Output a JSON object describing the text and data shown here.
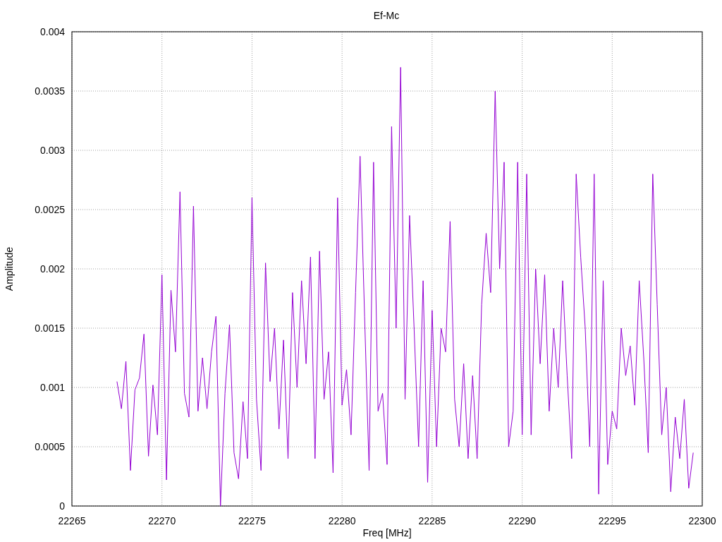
{
  "chart_data": {
    "type": "line",
    "grid": true,
    "title": "Ef-Mc",
    "xlabel": "Freq [MHz]",
    "ylabel": "Amplitude",
    "xlim": [
      22265,
      22300
    ],
    "ylim": [
      0,
      0.004
    ],
    "xticks": [
      22265,
      22270,
      22275,
      22280,
      22285,
      22290,
      22295,
      22300
    ],
    "yticks": [
      {
        "value": 0,
        "label": "0"
      },
      {
        "value": 0.0005,
        "label": "0.0005"
      },
      {
        "value": 0.001,
        "label": "0.001"
      },
      {
        "value": 0.0015,
        "label": "0.0015"
      },
      {
        "value": 0.002,
        "label": "0.002"
      },
      {
        "value": 0.0025,
        "label": "0.0025"
      },
      {
        "value": 0.003,
        "label": "0.003"
      },
      {
        "value": 0.0035,
        "label": "0.0035"
      },
      {
        "value": 0.004,
        "label": "0.004"
      }
    ],
    "x": [
      22267.5,
      22267.75,
      22268,
      22268.25,
      22268.5,
      22268.75,
      22269,
      22269.25,
      22269.5,
      22269.75,
      22270,
      22270.25,
      22270.5,
      22270.75,
      22271,
      22271.25,
      22271.5,
      22271.75,
      22272,
      22272.25,
      22272.5,
      22272.75,
      22273,
      22273.25,
      22273.5,
      22273.75,
      22274,
      22274.25,
      22274.5,
      22274.75,
      22275,
      22275.25,
      22275.5,
      22275.75,
      22276,
      22276.25,
      22276.5,
      22276.75,
      22277,
      22277.25,
      22277.5,
      22277.75,
      22278,
      22278.25,
      22278.5,
      22278.75,
      22279,
      22279.25,
      22279.5,
      22279.75,
      22280,
      22280.25,
      22280.5,
      22280.75,
      22281,
      22281.25,
      22281.5,
      22281.75,
      22282,
      22282.25,
      22282.5,
      22282.75,
      22283,
      22283.25,
      22283.5,
      22283.75,
      22284,
      22284.25,
      22284.5,
      22284.75,
      22285,
      22285.25,
      22285.5,
      22285.75,
      22286,
      22286.25,
      22286.5,
      22286.75,
      22287,
      22287.25,
      22287.5,
      22287.75,
      22288,
      22288.25,
      22288.5,
      22288.75,
      22289,
      22289.25,
      22289.5,
      22289.75,
      22290,
      22290.25,
      22290.5,
      22290.75,
      22291,
      22291.25,
      22291.5,
      22291.75,
      22292,
      22292.25,
      22292.5,
      22292.75,
      22293,
      22293.25,
      22293.5,
      22293.75,
      22294,
      22294.25,
      22294.5,
      22294.75,
      22295,
      22295.25,
      22295.5,
      22295.75,
      22296,
      22296.25,
      22296.5,
      22296.75,
      22297,
      22297.25,
      22297.5,
      22297.75,
      22298,
      22298.25,
      22298.5,
      22298.75,
      22299,
      22299.25,
      22299.5
    ],
    "series": [
      {
        "color": "#9400d3",
        "values": [
          0.00105,
          0.00082,
          0.00122,
          0.0003,
          0.00098,
          0.00108,
          0.00145,
          0.00042,
          0.00102,
          0.0006,
          0.00195,
          0.00022,
          0.00182,
          0.0013,
          0.00265,
          0.00095,
          0.00075,
          0.00253,
          0.0008,
          0.00125,
          0.00082,
          0.0013,
          0.0016,
          0,
          0.00095,
          0.00153,
          0.00045,
          0.00023,
          0.00088,
          0.0004,
          0.0026,
          0.0009,
          0.0003,
          0.00205,
          0.00105,
          0.0015,
          0.00065,
          0.0014,
          0.0004,
          0.0018,
          0.001,
          0.0019,
          0.0012,
          0.0021,
          0.0004,
          0.00215,
          0.0009,
          0.0013,
          0.00028,
          0.0026,
          0.00085,
          0.00115,
          0.0006,
          0.0018,
          0.00295,
          0.0016,
          0.0003,
          0.0029,
          0.0008,
          0.00095,
          0.00035,
          0.0032,
          0.0015,
          0.0037,
          0.0009,
          0.00245,
          0.0015,
          0.0005,
          0.0019,
          0.0002,
          0.00165,
          0.0005,
          0.0015,
          0.0013,
          0.0024,
          0.0009,
          0.0005,
          0.0012,
          0.0004,
          0.0011,
          0.0004,
          0.0017,
          0.0023,
          0.0018,
          0.0035,
          0.002,
          0.0029,
          0.0005,
          0.0008,
          0.0029,
          0.0006,
          0.0028,
          0.0006,
          0.002,
          0.0012,
          0.00195,
          0.0008,
          0.0015,
          0.001,
          0.0019,
          0.0011,
          0.0004,
          0.0028,
          0.0021,
          0.0015,
          0.0005,
          0.0028,
          0.0001,
          0.0019,
          0.00035,
          0.0008,
          0.00065,
          0.0015,
          0.0011,
          0.00135,
          0.00085,
          0.0019,
          0.00125,
          0.00045,
          0.0028,
          0.0017,
          0.0006,
          0.001,
          0.00012,
          0.00075,
          0.0004,
          0.0009,
          0.00015,
          0.00045
        ]
      }
    ]
  }
}
